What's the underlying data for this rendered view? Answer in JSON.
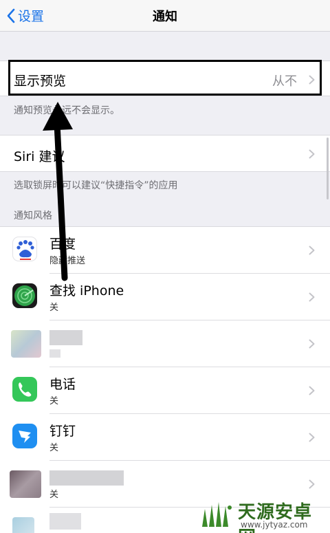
{
  "navbar": {
    "back_label": "设置",
    "title": "通知"
  },
  "preview": {
    "label": "显示预览",
    "value": "从不",
    "note": "通知预览永远不会显示。"
  },
  "siri": {
    "label": "Siri 建议",
    "note": "选取锁屏时可以建议“快捷指令”的应用"
  },
  "section_header": "通知风格",
  "apps": [
    {
      "name": "百度",
      "status": "隐藏推送",
      "icon": "baidu-icon",
      "icon_text": "du"
    },
    {
      "name": "查找 iPhone",
      "status": "关",
      "icon": "find-iphone-icon"
    },
    {
      "name": "",
      "status": "",
      "icon": "blurred-app-icon"
    },
    {
      "name": "电话",
      "status": "关",
      "icon": "phone-icon"
    },
    {
      "name": "钉钉",
      "status": "关",
      "icon": "dingtalk-icon"
    },
    {
      "name": "",
      "status": "关",
      "icon": "blurred-app-icon"
    }
  ],
  "watermark": {
    "name": "天源安卓网",
    "url": "www.jytyaz.com"
  },
  "colors": {
    "accent": "#1a73e8",
    "background": "#efeff4",
    "phone_green": "#34c759",
    "dingtalk_blue": "#1f8ff1"
  }
}
